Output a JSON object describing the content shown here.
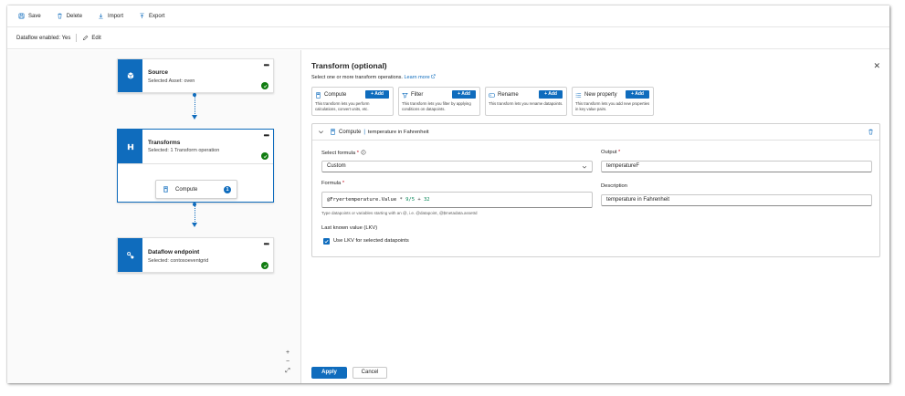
{
  "toolbar": {
    "save": "Save",
    "delete": "Delete",
    "import": "Import",
    "export": "Export"
  },
  "subbar": {
    "status": "Dataflow enabled: Yes",
    "edit": "Edit"
  },
  "nodes": {
    "source": {
      "title": "Source",
      "subtitle": "Selected Asset: oven",
      "more": "•••"
    },
    "transforms": {
      "title": "Transforms",
      "subtitle": "Selected: 1 Transform operation",
      "more": "•••"
    },
    "endpoint": {
      "title": "Dataflow endpoint",
      "subtitle": "Selected: contosoeventgrid",
      "more": "•••"
    }
  },
  "compute_chip": {
    "label": "Compute",
    "badge": "1"
  },
  "zoom": {
    "in": "+",
    "out": "−",
    "fit": "⤢"
  },
  "panel": {
    "title": "Transform (optional)",
    "close": "✕",
    "intro": "Select one or more transform operations.",
    "learn_more": "Learn more",
    "cards": [
      {
        "title": "Compute",
        "add": "+ Add",
        "desc": "This transform lets you perform calculations, convert units, etc."
      },
      {
        "title": "Filter",
        "add": "+ Add",
        "desc": "This transform lets you filter by applying conditions on datapoints."
      },
      {
        "title": "Rename",
        "add": "+ Add",
        "desc": "This transform lets you rename datapoints."
      },
      {
        "title": "New property",
        "add": "+ Add",
        "desc": "This transform lets you add new properties in key value pairs."
      }
    ],
    "section": {
      "name": "Compute",
      "description": "temperature in Fahrenheit",
      "select_formula_label": "Select formula",
      "select_formula_value": "Custom",
      "output_label": "Output",
      "output_value": "temperatureF",
      "formula_label": "Formula",
      "formula_var": "@Fryertemperature.Value",
      "formula_op1": "*",
      "formula_num1": "9/5",
      "formula_op2": "+",
      "formula_num2": "32",
      "formula_hint": "Type datapoints or variables starting with an @, i.e. @datapoint, @$metadata.assetId",
      "description_label": "Description",
      "description_value": "temperature in Fahrenheit",
      "lkv_label": "Last known value (LKV)",
      "lkv_checkbox": "Use LKV for selected datapoints",
      "required_mark": "*"
    },
    "apply": "Apply",
    "cancel": "Cancel"
  },
  "colors": {
    "accent": "#0f6cbd",
    "success": "#107c10",
    "required": "#c50f1f"
  }
}
